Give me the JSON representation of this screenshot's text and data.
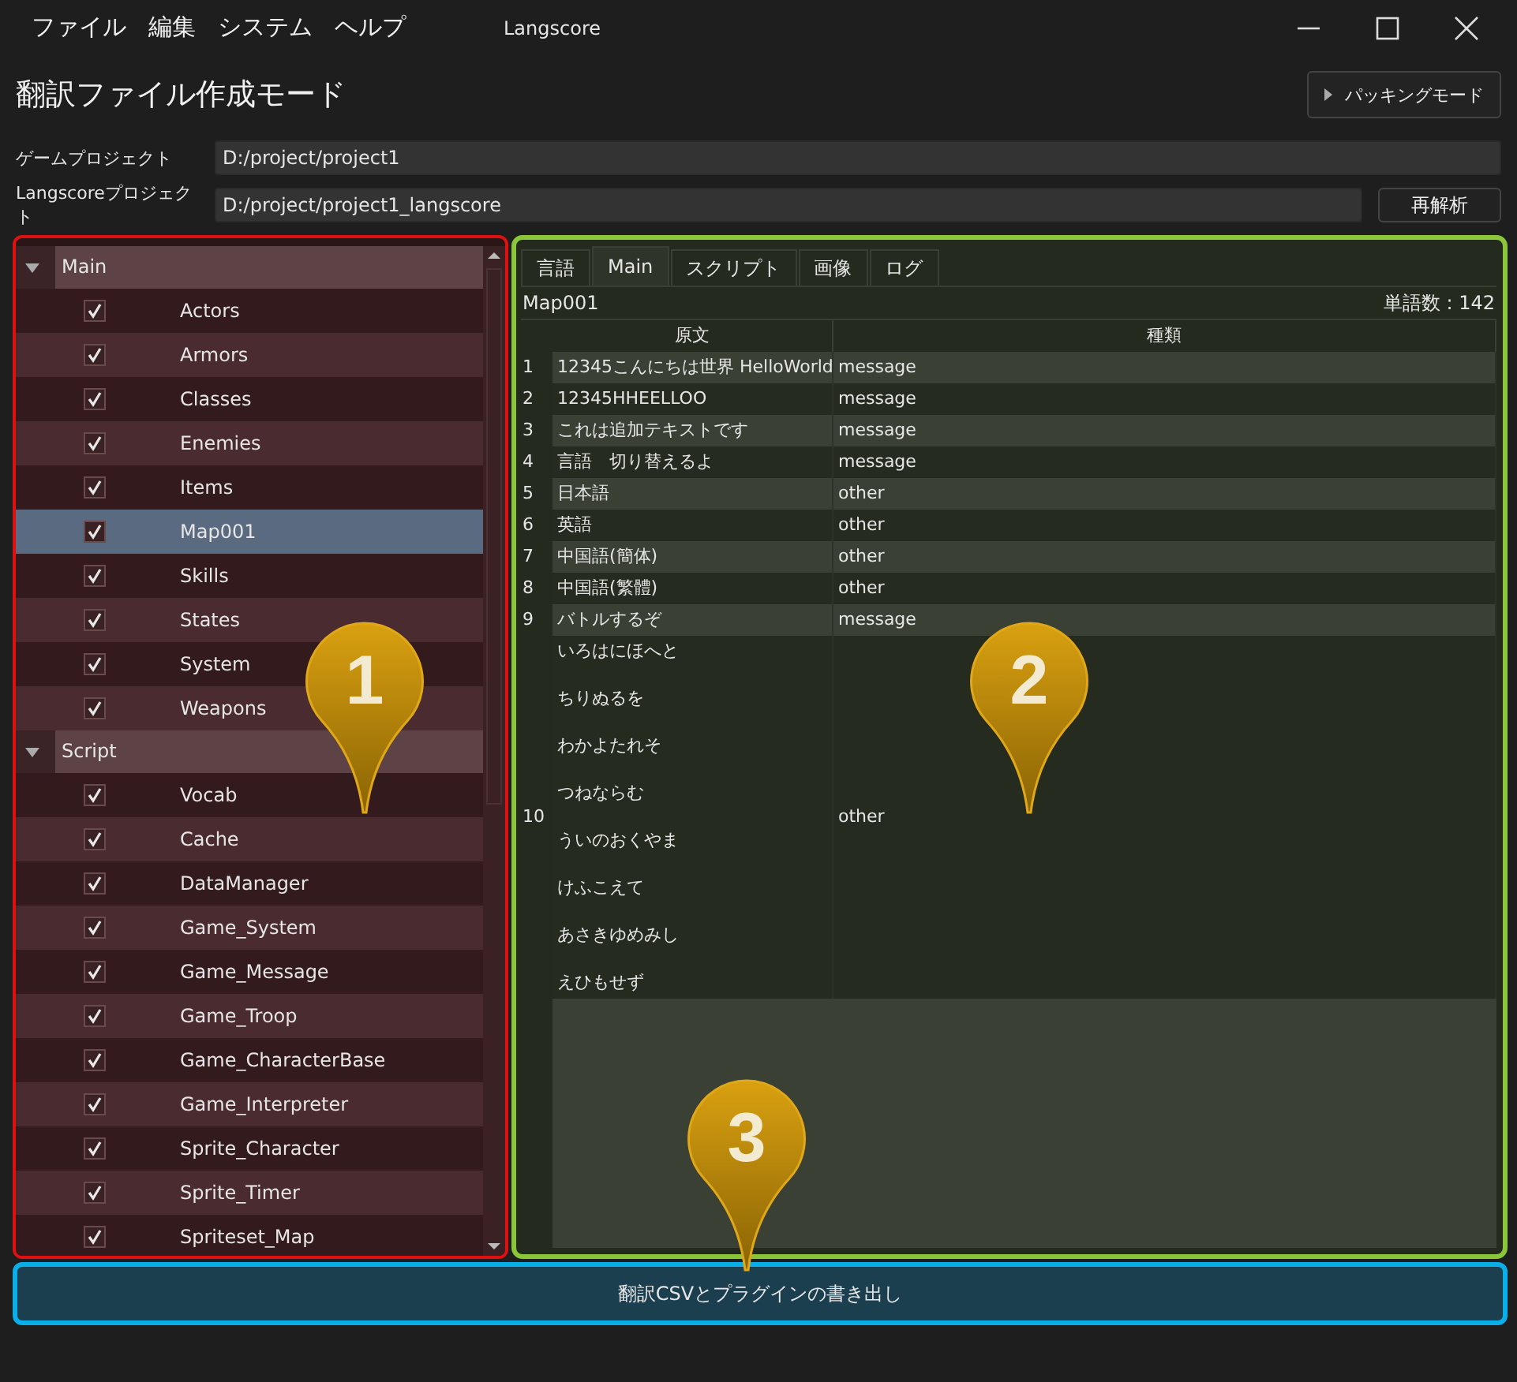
{
  "window": {
    "title": "Langscore"
  },
  "menu": [
    "ファイル",
    "編集",
    "システム",
    "ヘルプ"
  ],
  "header": {
    "title": "翻訳ファイル作成モード",
    "mode_button": "パッキングモード"
  },
  "paths": [
    {
      "label": "ゲームプロジェクト",
      "value": "D:/project/project1"
    },
    {
      "label": "Langscoreプロジェクト",
      "value": "D:/project/project1_langscore",
      "button": "再解析"
    }
  ],
  "tree": [
    {
      "label": "Main",
      "expanded": true,
      "children": [
        {
          "label": "Actors",
          "checked": true,
          "selected": false
        },
        {
          "label": "Armors",
          "checked": true,
          "selected": false
        },
        {
          "label": "Classes",
          "checked": true,
          "selected": false
        },
        {
          "label": "Enemies",
          "checked": true,
          "selected": false
        },
        {
          "label": "Items",
          "checked": true,
          "selected": false
        },
        {
          "label": "Map001",
          "checked": true,
          "selected": true
        },
        {
          "label": "Skills",
          "checked": true,
          "selected": false
        },
        {
          "label": "States",
          "checked": true,
          "selected": false
        },
        {
          "label": "System",
          "checked": true,
          "selected": false
        },
        {
          "label": "Weapons",
          "checked": true,
          "selected": false
        }
      ]
    },
    {
      "label": "Script",
      "expanded": true,
      "children": [
        {
          "label": "Vocab",
          "checked": true,
          "selected": false
        },
        {
          "label": "Cache",
          "checked": true,
          "selected": false
        },
        {
          "label": "DataManager",
          "checked": true,
          "selected": false
        },
        {
          "label": "Game_System",
          "checked": true,
          "selected": false
        },
        {
          "label": "Game_Message",
          "checked": true,
          "selected": false
        },
        {
          "label": "Game_Troop",
          "checked": true,
          "selected": false
        },
        {
          "label": "Game_CharacterBase",
          "checked": true,
          "selected": false
        },
        {
          "label": "Game_Interpreter",
          "checked": true,
          "selected": false
        },
        {
          "label": "Sprite_Character",
          "checked": true,
          "selected": false
        },
        {
          "label": "Sprite_Timer",
          "checked": true,
          "selected": false
        },
        {
          "label": "Spriteset_Map",
          "checked": true,
          "selected": false
        }
      ]
    }
  ],
  "tabs": [
    {
      "label": "言語",
      "selected": false
    },
    {
      "label": "Main",
      "selected": true
    },
    {
      "label": "スクリプト",
      "selected": false
    },
    {
      "label": "画像",
      "selected": false
    },
    {
      "label": "ログ",
      "selected": false
    }
  ],
  "table": {
    "caption": "Map001",
    "count": "単語数 : 142",
    "columns": [
      "原文",
      "種類"
    ],
    "rows": [
      {
        "number": "1",
        "text": "12345こんにちは世界 HelloWorld",
        "type": "message"
      },
      {
        "number": "2",
        "text": "12345HHEELLOO",
        "type": "message"
      },
      {
        "number": "3",
        "text": "これは追加テキストです",
        "type": "message"
      },
      {
        "number": "4",
        "text": "言語　切り替えるよ",
        "type": "message"
      },
      {
        "number": "5",
        "text": "日本語",
        "type": "other"
      },
      {
        "number": "6",
        "text": "英語",
        "type": "other"
      },
      {
        "number": "7",
        "text": "中国語(簡体)",
        "type": "other"
      },
      {
        "number": "8",
        "text": "中国語(繁體)",
        "type": "other"
      },
      {
        "number": "9",
        "text": "バトルするぞ",
        "type": "message"
      },
      {
        "number": "10",
        "lines": [
          "いろはにほへと",
          "ちりぬるを",
          "わかよたれそ",
          "つねならむ",
          "ういのおくやま",
          "けふこえて",
          "あさきゆめみし",
          "えひもせず"
        ],
        "type": "other"
      }
    ]
  },
  "export_button": "翻訳CSVとプラグインの書き出し",
  "callouts": [
    {
      "number": "1"
    },
    {
      "number": "2"
    },
    {
      "number": "3"
    }
  ]
}
